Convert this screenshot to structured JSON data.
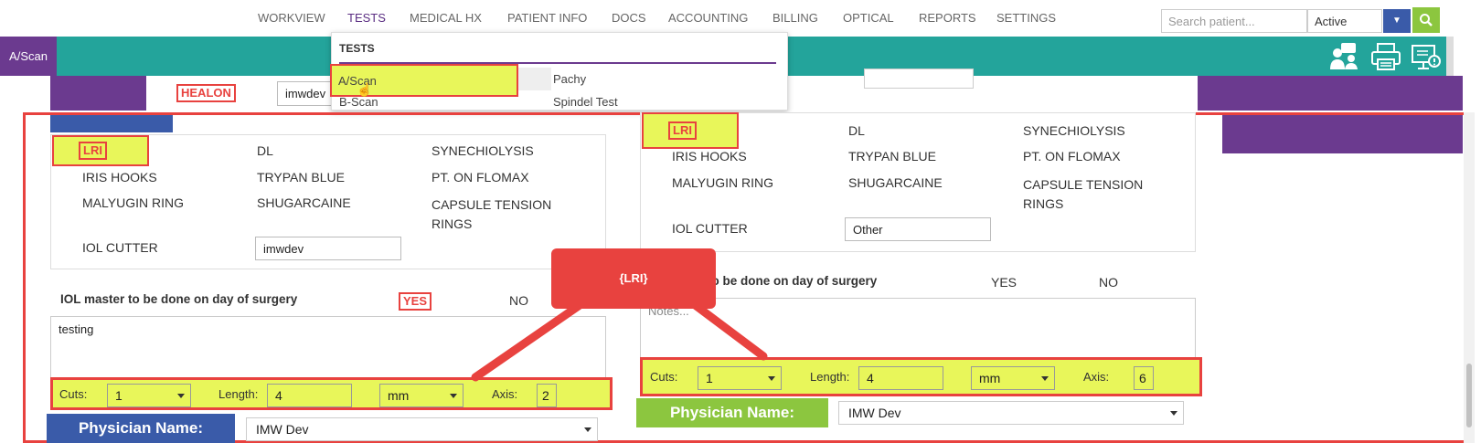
{
  "nav": {
    "items": [
      "WORKVIEW",
      "TESTS",
      "MEDICAL HX",
      "PATIENT INFO",
      "DOCS",
      "ACCOUNTING",
      "BILLING",
      "OPTICAL",
      "REPORTS",
      "SETTINGS"
    ],
    "search_placeholder": "Search patient...",
    "status_value": "Active"
  },
  "tab": {
    "label": "A/Scan"
  },
  "tests_menu": {
    "title": "TESTS",
    "col1": [
      "A/Scan",
      "B-Scan"
    ],
    "col2": [
      "Pachy",
      "Spindel Test"
    ]
  },
  "left": {
    "healon": "HEALON",
    "top_input": "imwdev",
    "options": {
      "lri": "LRI",
      "dl": "DL",
      "synechiolysis": "SYNECHIOLYSIS",
      "iris_hooks": "IRIS HOOKS",
      "trypan_blue": "TRYPAN BLUE",
      "pt_on_flomax": "PT. ON FLOMAX",
      "malyugin_ring": "MALYUGIN RING",
      "shugarcaine": "SHUGARCAINE",
      "capsule_tension_rings": "CAPSULE TENSION RINGS",
      "iol_cutter": "IOL CUTTER"
    },
    "iol_cutter_value": "imwdev",
    "iol_master_label": "IOL master to be done on day of surgery",
    "yes": "YES",
    "no": "NO",
    "notes": "testing",
    "cuts_label": "Cuts:",
    "cuts_value": "1",
    "length_label": "Length:",
    "length_value": "4",
    "unit_value": "mm",
    "axis_label": "Axis:",
    "axis_value": "2",
    "physician_label": "Physician Name:",
    "physician_value": "IMW Dev"
  },
  "right": {
    "options": {
      "lri": "LRI",
      "dl": "DL",
      "synechiolysis": "SYNECHIOLYSIS",
      "iris_hooks": "IRIS HOOKS",
      "trypan_blue": "TRYPAN BLUE",
      "pt_on_flomax": "PT. ON FLOMAX",
      "malyugin_ring": "MALYUGIN RING",
      "shugarcaine": "SHUGARCAINE",
      "capsule_tension_rings": "CAPSULE TENSION RINGS",
      "iol_cutter": "IOL CUTTER"
    },
    "iol_cutter_value": "Other",
    "iol_master_label": "r to be done on day of surgery",
    "yes": "YES",
    "no": "NO",
    "notes_placeholder": "Notes...",
    "cuts_label": "Cuts:",
    "cuts_value": "1",
    "length_label": "Length:",
    "length_value": "4",
    "unit_value": "mm",
    "axis_label": "Axis:",
    "axis_value": "6",
    "physician_label": "Physician Name:",
    "physician_value": "IMW Dev"
  },
  "callout": {
    "text": "{LRI}"
  },
  "colors": {
    "teal": "#23a49b",
    "purple": "#6b3a8f",
    "highlight": "#e8f65a",
    "annotation_red": "#e8423f",
    "green": "#8cc63f",
    "blue": "#3a5ba9"
  }
}
